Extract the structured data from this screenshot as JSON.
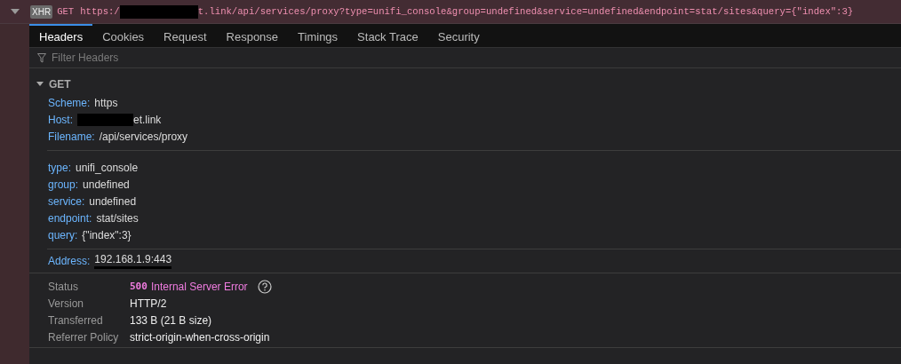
{
  "request": {
    "expanded": true,
    "badge": "XHR",
    "method": "GET",
    "url_start": "https:/",
    "url_end": "t.link/api/services/proxy?type=unifi_console&group=undefined&service=undefined&endpoint=stat/sites&query={\"index\":3}"
  },
  "tabs": [
    {
      "label": "Headers",
      "selected": true
    },
    {
      "label": "Cookies",
      "selected": false
    },
    {
      "label": "Request",
      "selected": false
    },
    {
      "label": "Response",
      "selected": false
    },
    {
      "label": "Timings",
      "selected": false
    },
    {
      "label": "Stack Trace",
      "selected": false
    },
    {
      "label": "Security",
      "selected": false
    }
  ],
  "filter": {
    "placeholder": "Filter Headers"
  },
  "section": {
    "title": "GET",
    "expanded": true
  },
  "url_fields": [
    {
      "key": "Scheme:",
      "value": "https",
      "redacted": false
    },
    {
      "key": "Host:",
      "value": "et.link",
      "redacted": true
    },
    {
      "key": "Filename:",
      "value": "/api/services/proxy",
      "redacted": false
    }
  ],
  "query_fields": [
    {
      "key": "type:",
      "value": "unifi_console"
    },
    {
      "key": "group:",
      "value": "undefined"
    },
    {
      "key": "service:",
      "value": "undefined"
    },
    {
      "key": "endpoint:",
      "value": "stat/sites"
    },
    {
      "key": "query:",
      "value": "{\"index\":3}"
    }
  ],
  "address": {
    "key": "Address:",
    "value": "192.168.1.9:443"
  },
  "summary": [
    {
      "label": "Status",
      "kind": "status",
      "code": "500",
      "value": "Internal Server Error"
    },
    {
      "label": "Version",
      "kind": "text",
      "value": "HTTP/2"
    },
    {
      "label": "Transferred",
      "kind": "text",
      "value": "133 B (21 B size)"
    },
    {
      "label": "Referrer Policy",
      "kind": "text",
      "value": "strict-origin-when-cross-origin"
    }
  ]
}
